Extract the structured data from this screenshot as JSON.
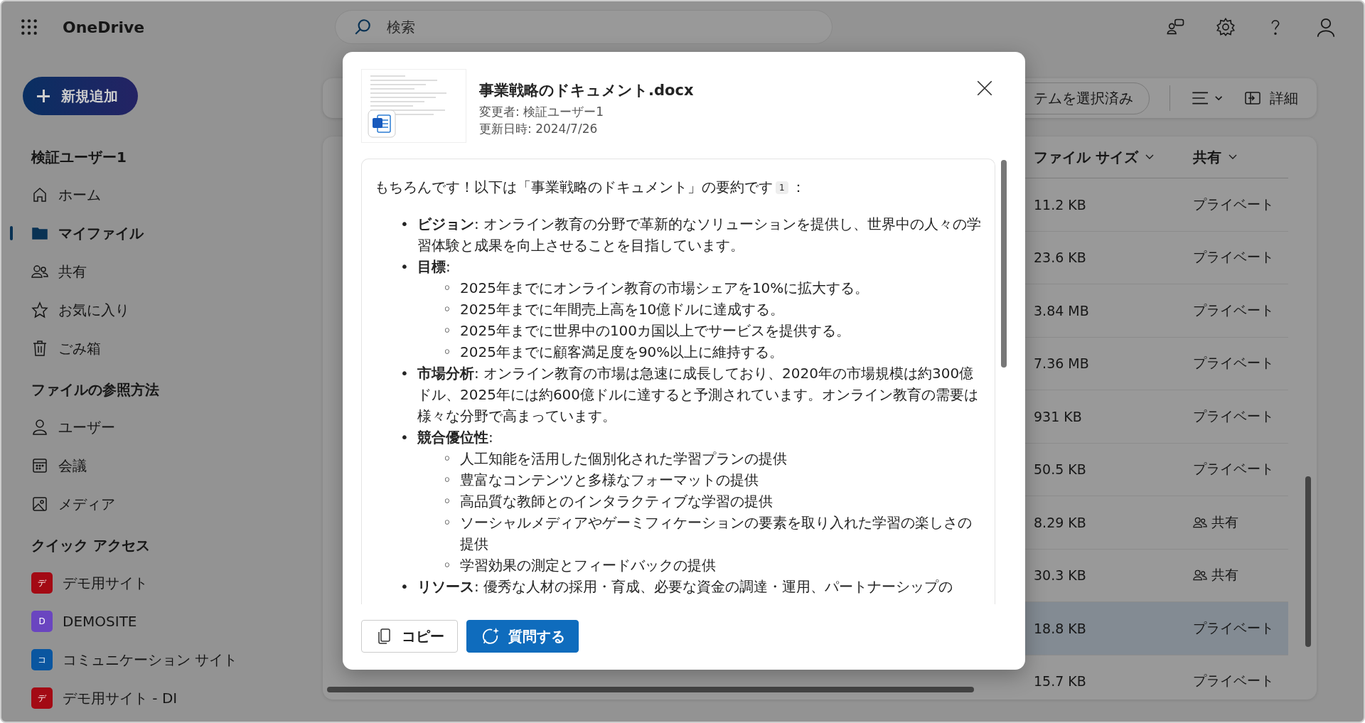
{
  "app": {
    "name": "OneDrive"
  },
  "search": {
    "placeholder": "検索"
  },
  "sidebar": {
    "new_button": "新規追加",
    "sections": [
      {
        "title": "検証ユーザー1",
        "items": [
          {
            "label": "ホーム",
            "selected": false
          },
          {
            "label": "マイファイル",
            "selected": true
          },
          {
            "label": "共有",
            "selected": false
          },
          {
            "label": "お気に入り",
            "selected": false
          },
          {
            "label": "ごみ箱",
            "selected": false
          }
        ]
      },
      {
        "title": "ファイルの参照方法",
        "items": [
          {
            "label": "ユーザー",
            "selected": false
          },
          {
            "label": "会議",
            "selected": false
          },
          {
            "label": "メディア",
            "selected": false
          }
        ]
      },
      {
        "title": "クイック アクセス",
        "items": [
          {
            "label": "デモ用サイト",
            "badge": "デ",
            "color": "#a30a14",
            "selected": false
          },
          {
            "label": "DEMOSITE",
            "badge": "D",
            "color": "#6a45c0",
            "selected": false
          },
          {
            "label": "コミュニケーション サイト",
            "badge": "コ",
            "color": "#0a56a0",
            "selected": false
          },
          {
            "label": "デモ用サイト - DI",
            "badge": "デ",
            "color": "#a30a14",
            "selected": false
          }
        ]
      }
    ]
  },
  "toolbar": {
    "selection": "テムを選択済み",
    "details": "詳細"
  },
  "table": {
    "columns": [
      "ファイル サイズ",
      "共有"
    ],
    "rows": [
      {
        "size": "11.2 KB",
        "sharing": "プライベート",
        "shared": false,
        "selected": false
      },
      {
        "size": "23.6 KB",
        "sharing": "プライベート",
        "shared": false,
        "selected": false
      },
      {
        "size": "3.84 MB",
        "sharing": "プライベート",
        "shared": false,
        "selected": false
      },
      {
        "size": "7.36 MB",
        "sharing": "プライベート",
        "shared": false,
        "selected": false
      },
      {
        "size": "931 KB",
        "sharing": "プライベート",
        "shared": false,
        "selected": false
      },
      {
        "size": "50.5 KB",
        "sharing": "プライベート",
        "shared": false,
        "selected": false
      },
      {
        "size": "8.29 KB",
        "sharing": "共有",
        "shared": true,
        "selected": false
      },
      {
        "size": "30.3 KB",
        "sharing": "共有",
        "shared": true,
        "selected": false
      },
      {
        "size": "18.8 KB",
        "sharing": "プライベート",
        "shared": false,
        "selected": true
      },
      {
        "size": "15.7 KB",
        "sharing": "プライベート",
        "shared": false,
        "selected": false
      }
    ]
  },
  "dialog": {
    "file_name": "事業戦略のドキュメント.docx",
    "modified_by": "変更者: 検証ユーザー1",
    "updated": "更新日時: 2024/7/26",
    "summary": {
      "intro": "もちろんです！以下は「事業戦略のドキュメント」の要約です",
      "citation": "1",
      "intro_end": "：",
      "bullets": [
        {
          "marker": "•",
          "term": "ビジョン",
          "text": ": オンライン教育の分野で革新的なソリューションを提供し、世界中の人々の学習体験と成果を向上させることを目指しています。"
        },
        {
          "marker": "•",
          "term": "目標",
          "text": ":",
          "children": [
            {
              "marker": "◦",
              "text": "2025年までにオンライン教育の市場シェアを10%に拡大する。"
            },
            {
              "marker": "◦",
              "text": "2025年までに年間売上高を10億ドルに達成する。"
            },
            {
              "marker": "◦",
              "text": "2025年までに世界中の100カ国以上でサービスを提供する。"
            },
            {
              "marker": "◦",
              "text": "2025年までに顧客満足度を90%以上に維持する。"
            }
          ]
        },
        {
          "marker": "•",
          "term": "市場分析",
          "text": ": オンライン教育の市場は急速に成長しており、2020年の市場規模は約300億ドル、2025年には約600億ドルに達すると予測されています。オンライン教育の需要は様々な分野で高まっています。"
        },
        {
          "marker": "•",
          "term": "競合優位性",
          "text": ":",
          "children": [
            {
              "marker": "◦",
              "text": "人工知能を活用した個別化された学習プランの提供"
            },
            {
              "marker": "◦",
              "text": "豊富なコンテンツと多様なフォーマットの提供"
            },
            {
              "marker": "◦",
              "text": "高品質な教師とのインタラクティブな学習の提供"
            },
            {
              "marker": "◦",
              "text": "ソーシャルメディアやゲーミフィケーションの要素を取り入れた学習の楽しさの提供"
            },
            {
              "marker": "◦",
              "text": "学習効果の測定とフィードバックの提供"
            }
          ]
        },
        {
          "marker": "•",
          "term": "リソース",
          "text": ": 優秀な人材の採用・育成、必要な資金の調達・運用、パートナーシップの"
        }
      ]
    },
    "buttons": [
      {
        "label": "コピー",
        "kind": "copy"
      },
      {
        "label": "質問する",
        "kind": "ask"
      }
    ]
  }
}
